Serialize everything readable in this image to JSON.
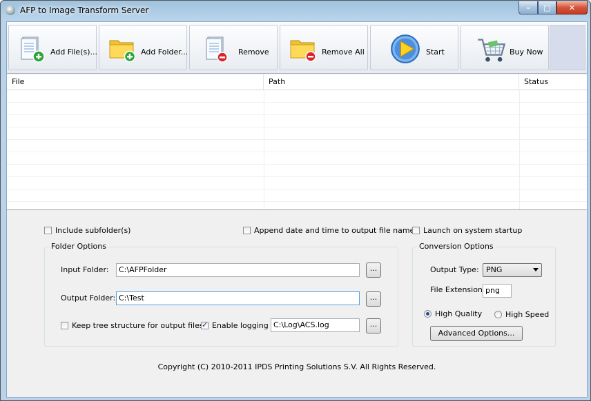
{
  "window": {
    "title": "AFP to Image Transform Server",
    "min_glyph": "–",
    "max_glyph": "□",
    "close_glyph": "✕"
  },
  "toolbar": {
    "buttons": [
      {
        "label": "Add File(s)...",
        "icon": "add-file-icon"
      },
      {
        "label": "Add Folder...",
        "icon": "add-folder-icon"
      },
      {
        "label": "Remove",
        "icon": "remove-file-icon"
      },
      {
        "label": "Remove All",
        "icon": "remove-all-folder-icon"
      },
      {
        "label": "Start",
        "icon": "play-icon"
      },
      {
        "label": "Buy Now",
        "icon": "shopping-cart-icon"
      }
    ]
  },
  "file_grid": {
    "columns": [
      "File",
      "Path",
      "Status"
    ],
    "rows": []
  },
  "options": {
    "include_subfolders": {
      "label": "Include subfolder(s)",
      "checked": false
    },
    "append_datetime": {
      "label": "Append date and time to output file name",
      "checked": false
    },
    "launch_startup": {
      "label": "Launch on system startup",
      "checked": false
    }
  },
  "folder_options": {
    "title": "Folder Options",
    "input_label": "Input Folder:",
    "input_value": "C:\\AFPFolder",
    "output_label": "Output Folder:",
    "output_value": "C:\\Test",
    "browse_label": "...",
    "keep_tree": {
      "label": "Keep tree structure for output files",
      "checked": false
    },
    "enable_logging": {
      "label": "Enable logging",
      "checked": true
    },
    "log_path": "C:\\Log\\ACS.log"
  },
  "conversion_options": {
    "title": "Conversion Options",
    "output_type_label": "Output Type:",
    "output_type_value": "PNG",
    "file_ext_label": "File Extension:",
    "file_ext_value": "png",
    "high_quality": {
      "label": "High Quality",
      "selected": true
    },
    "high_speed": {
      "label": "High Speed",
      "selected": false
    },
    "advanced_label": "Advanced Options..."
  },
  "footer": {
    "copyright": "Copyright (C) 2010-2011 IPDS Printing Solutions S.V.  All Rights Reserved."
  },
  "colors": {
    "title_gradient": "#b9d4ea",
    "close_red": "#d6533a",
    "accent_green": "#2ea43a",
    "accent_red": "#d8262b"
  }
}
